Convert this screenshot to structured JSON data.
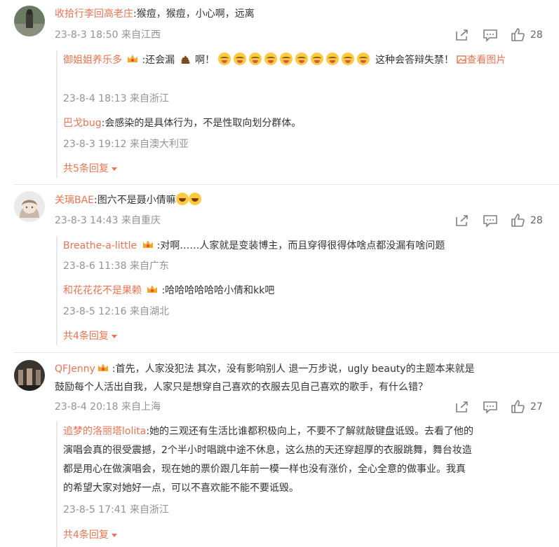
{
  "comments": [
    {
      "username": "收拾行李回高老庄",
      "text": ":猴痘，猴痘，小心啊，远离",
      "meta": "23-8-3 18:50 来自江西",
      "likes": "28",
      "replies": [
        {
          "username": "御姐姐养乐多",
          "text_a": ":还会漏",
          "text_b": "啊！",
          "text_c": "这种会答辩失禁！",
          "link_text": "查看图片",
          "meta": "23-8-4 18:13 来自浙江"
        },
        {
          "username": "巴戈bug",
          "text": ":会感染的是具体行为，不是性取向划分群体。",
          "meta": "23-8-3 19:12 来自澳大利亚"
        }
      ],
      "more": "共5条回复"
    },
    {
      "username": "关璃BAE",
      "text": ":图六不是聂小倩嘛",
      "meta": "23-8-3 14:43 来自重庆",
      "likes": "28",
      "replies": [
        {
          "username": "Breathe-a-little",
          "text": ":对啊……人家就是变装博主，而且穿得很得体啥点都没漏有啥问题",
          "meta": "23-8-6 11:38 来自广东"
        },
        {
          "username": "和花花花不是果赖",
          "text": ":哈哈哈哈哈哈小倩和kk吧",
          "meta": "23-8-5 12:16 来自湖北"
        }
      ],
      "more": "共4条回复"
    },
    {
      "username": "QFJenny",
      "text_line1": ":首先，人家没犯法 其次，没有影响别人 退一万步说，ugly beauty的主题本来就是",
      "text_line2": "鼓励每个人活出自我，人家只是想穿自己喜欢的衣服去见自己喜欢的歌手，有什么错？",
      "meta": "23-8-4 20:18 来自上海",
      "likes": "27",
      "replies": [
        {
          "username": "追梦的洛丽塔lolita",
          "line1": ":她的三观还有生活比谁都积极向上，不要不了解就敲键盘诋毁。去看了他的",
          "line2": "演唱会真的很受震撼，2个半小时唱跳中途不休息，这么热的天还穿超厚的衣服跳舞，舞台妆造",
          "line3": "都是用心在做演唱会，现在她的票价跟几年前一模一样也没有涨价，全心全意的做事业。我真",
          "line4": "的希望大家对她好一点，可以不喜欢能不能不要诋毁。",
          "meta": "23-8-5 17:41 来自浙江"
        }
      ],
      "more": "共4条回复"
    }
  ],
  "icons": {
    "share": "share-icon",
    "comment": "comment-icon",
    "like": "thumbs-up-icon",
    "badge": "crown-badge-icon",
    "image": "image-icon"
  },
  "colors": {
    "username": "#eb7350",
    "meta": "#939393",
    "text": "#333333",
    "divider": "#e6e6e6"
  }
}
